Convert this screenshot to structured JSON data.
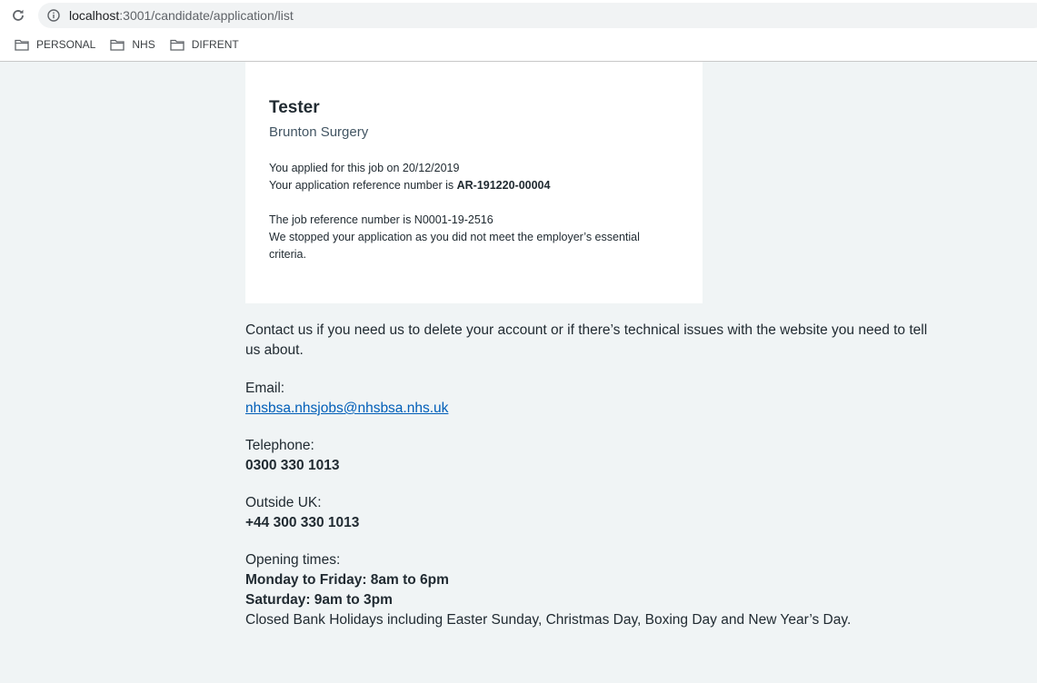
{
  "browser": {
    "url_host": "localhost",
    "url_path": ":3001/candidate/application/list",
    "bookmarks": [
      "PERSONAL",
      "NHS",
      "DIFRENT"
    ]
  },
  "application": {
    "title": "Tester",
    "employer": "Brunton Surgery",
    "applied_line": "You applied for this job on 20/12/2019",
    "ref_prefix": "Your application reference number is ",
    "ref_number": "AR-191220-00004",
    "job_ref_line": "The job reference number is N0001-19-2516",
    "status_line": "We stopped your application as you did not meet the employer’s essential criteria."
  },
  "contact": {
    "intro": "Contact us if you need us to delete your account or if there’s technical issues with the website you need to tell us about.",
    "email_label": "Email:",
    "email": "nhsbsa.nhsjobs@nhsbsa.nhs.uk",
    "telephone_label": "Telephone:",
    "telephone": "0300 330 1013",
    "outside_label": "Outside UK:",
    "outside": "+44 300 330 1013",
    "opening_label": "Opening times:",
    "weekday_hours": "Monday to Friday: 8am to 6pm",
    "saturday_hours": "Saturday: 9am to 3pm",
    "closed_note": "Closed Bank Holidays including Easter Sunday, Christmas Day, Boxing Day and New Year’s Day."
  },
  "colors": {
    "page_bg": "#f0f4f5",
    "link": "#005eb8",
    "text": "#212b32",
    "secondary_text": "#425563"
  }
}
